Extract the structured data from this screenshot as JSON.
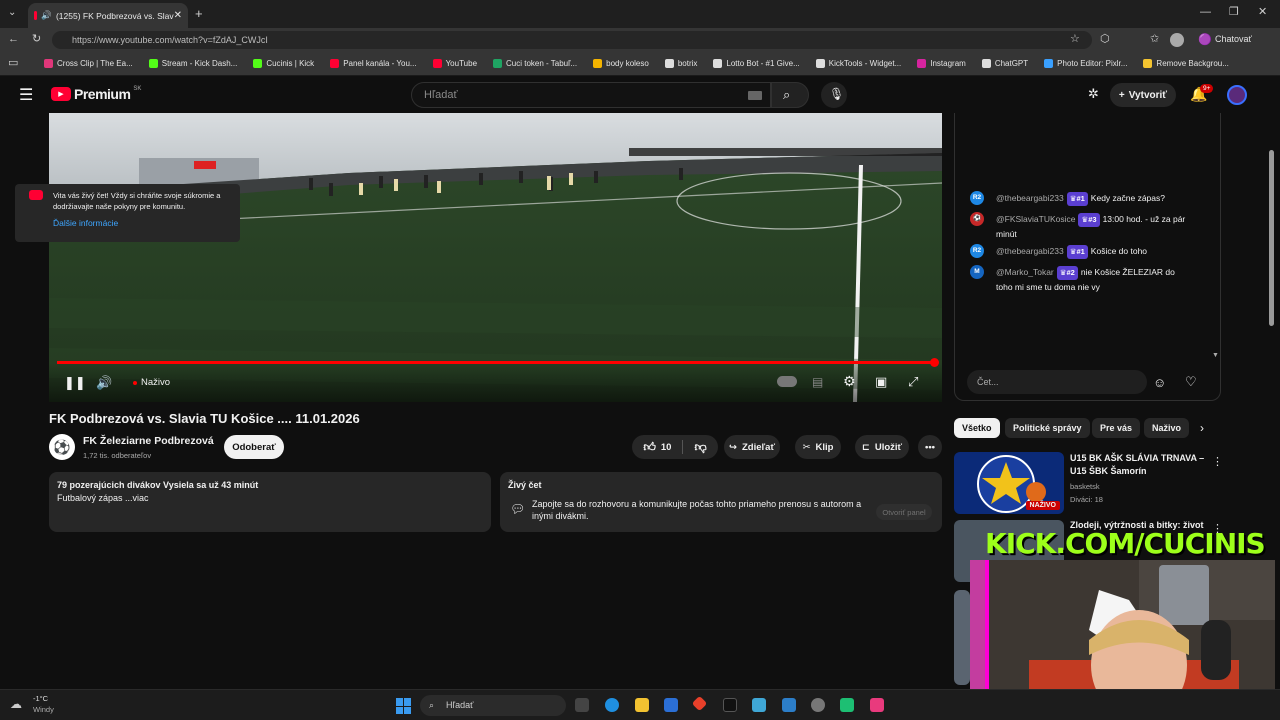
{
  "browser": {
    "tab_title": "(1255) FK Podbrezová vs. Slav",
    "url": "https://www.youtube.com/watch?v=fZdAJ_CWJcI",
    "chat_button": "Chatovať",
    "bookmarks": [
      {
        "label": "Cross Clip | The Ea...",
        "color": "#e0377a"
      },
      {
        "label": "Stream - Kick Dash...",
        "color": "#53fc18"
      },
      {
        "label": "Cucinis | Kick",
        "color": "#53fc18"
      },
      {
        "label": "Panel kanála - You...",
        "color": "#ff0033"
      },
      {
        "label": "YouTube",
        "color": "#ff0033"
      },
      {
        "label": "Cuci token - Tabuľ...",
        "color": "#1fa463"
      },
      {
        "label": "body koleso",
        "color": "#f4b400"
      },
      {
        "label": "botrix",
        "color": "#dddddd"
      },
      {
        "label": "Lotto Bot - #1 Give...",
        "color": "#dddddd"
      },
      {
        "label": "KickTools - Widget...",
        "color": "#dddddd"
      },
      {
        "label": "Instagram",
        "color": "#d6249f"
      },
      {
        "label": "ChatGPT",
        "color": "#dddddd"
      },
      {
        "label": "Photo Editor: Pixlr...",
        "color": "#3aa0ff"
      },
      {
        "label": "Remove Backgrou...",
        "color": "#f4c430"
      }
    ]
  },
  "youtube": {
    "logo": "Premium",
    "region": "SK",
    "search_placeholder": "Hľadať",
    "create_label": "Vytvoriť",
    "notifications": "9+"
  },
  "player": {
    "live_label": "Naživo"
  },
  "video": {
    "title": "FK Podbrezová vs. Slavia TU Košice .... 11.01.2026",
    "channel_name": "FK Železiarne Podbrezová",
    "subscribers": "1,72 tis. odberateľov",
    "subscribe_label": "Odoberať",
    "likes": "10",
    "share_label": "Zdieľať",
    "clip_label": "Klip",
    "save_label": "Uložiť",
    "description_stats": "79 pozerajúcich divákov  Vysiela sa už 43 minút",
    "description_text": "Futbalový zápas ...viac",
    "chat_section_title": "Živý čet",
    "chat_section_text": "Zapojte sa do rozhovoru a komunikujte počas tohto priameho prenosu s autorom a inými divákmi.",
    "open_panel_label": "Otvoriť panel"
  },
  "chat": {
    "messages": [
      {
        "avatar": "R2",
        "avatar_color": "#1e88e5",
        "user": "@thebeargabi233",
        "badge": "#1",
        "text": "Kedy začne zápas?"
      },
      {
        "avatar": "⚽",
        "avatar_color": "#c62828",
        "user": "@FKSlaviaTUKosice",
        "badge": "#3",
        "text": "13:00 hod. - už za pár minút"
      },
      {
        "avatar": "R2",
        "avatar_color": "#1e88e5",
        "user": "@thebeargabi233",
        "badge": "#1",
        "text": "Košice do toho"
      },
      {
        "avatar": "M",
        "avatar_color": "#1565c0",
        "user": "@Marko_Tokar",
        "badge": "#2",
        "text": "nie Košice ŽELEZIAR do toho mi sme tu doma nie vy"
      }
    ],
    "welcome_text": "Vitajte v živom čete! Vždy si chráňte svoje súkromie a dodržiavajte naše pokyny pre komunitu.",
    "welcome_text_display": "Vita vás živý čet! Vždy si chráňte svoje súkromie a dodržiavajte naše pokyny pre komunitu.",
    "learn_more": "Ďalšie informácie",
    "input_placeholder": "Čet..."
  },
  "chips": [
    "Všetko",
    "Politické správy",
    "Pre vás",
    "Naživo"
  ],
  "recommendations": [
    {
      "title": "U15 BK AŠK SLÁVIA TRNAVA – U15 ŠBK Šamorín",
      "channel": "basketsk",
      "meta": "Diváci: 18",
      "badge": "NAŽIVO"
    },
    {
      "title": "Zlodeji, výtržnosti a bitky: život",
      "channel": "",
      "meta": "",
      "badge": ""
    }
  ],
  "overlay": {
    "banner": "KICK.COM/CUCINIS"
  },
  "taskbar": {
    "weather_temp": "-1°C",
    "weather_desc": "Windy",
    "search_placeholder": "Hľadať"
  }
}
